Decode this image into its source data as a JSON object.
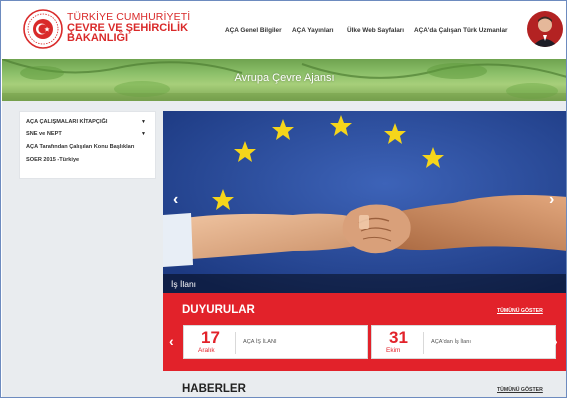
{
  "header": {
    "brand_line1": "TÜRKİYE CUMHURİYETİ",
    "brand_line2": "ÇEVRE VE ŞEHİRCİLİK",
    "brand_line3": "BAKANLIĞI",
    "nav": [
      {
        "label": "AÇA Genel Bilgiler"
      },
      {
        "label": "AÇA Yayınları"
      },
      {
        "label": "Ülke Web Sayfaları"
      },
      {
        "label": "AÇA'da Çalışan Türk Uzmanlar"
      }
    ]
  },
  "banner": {
    "title": "Avrupa Çevre Ajansı"
  },
  "sidebar": {
    "items": [
      {
        "label": "AÇA ÇALIŞMALARI KİTAPÇIĞI",
        "caret": "▼"
      },
      {
        "label": "SNE ve NEPT",
        "caret": "▼"
      },
      {
        "label": "AÇA Tarafından Çalışılan Konu Başlıkları"
      },
      {
        "label": "SOER 2015 -Türkiye"
      }
    ]
  },
  "slider": {
    "caption": "İş İlanı",
    "prev": "‹",
    "next": "›"
  },
  "announcements": {
    "title": "DUYURULAR",
    "show_all": "TÜMÜNÜ GÖSTER",
    "prev": "‹",
    "next": "›",
    "items": [
      {
        "day": "17",
        "month": "Aralık",
        "text": "AÇA İŞ İLANI"
      },
      {
        "day": "31",
        "month": "Ekim",
        "text": "AÇA'dan İş İlanı"
      }
    ]
  },
  "news": {
    "title": "HABERLER",
    "show_all": "TÜMÜNÜ GÖSTER"
  },
  "colors": {
    "accent_red": "#e2222a",
    "brand_red": "#d92a2a",
    "eu_blue": "#2a4ea3",
    "eu_star": "#f5d51b",
    "page_bg": "#e9ecef"
  },
  "icons": [
    "ministry-seal-icon",
    "user-avatar",
    "chevron-left-icon",
    "chevron-right-icon",
    "caret-down-icon"
  ]
}
